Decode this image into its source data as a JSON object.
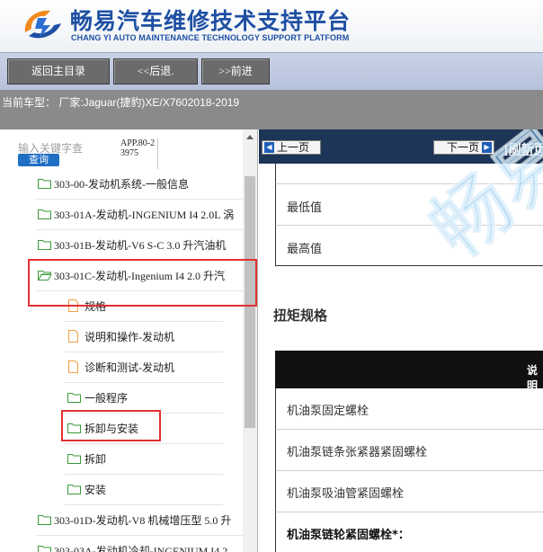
{
  "header": {
    "title_cn": "畅易汽车维修技术支持平台",
    "title_en": "CHANG YI AUTO MAINTENANCE TECHNOLOGY SUPPORT PLATFORM",
    "logo_icon": "cy-logo-icon"
  },
  "toolbar": {
    "home_label": "返回主目录",
    "back_label": "<<后退.",
    "forward_label": ">>前进"
  },
  "vehicle": {
    "label": "当前车型： 厂家:Jaguar(捷豹)XE/X7602018-2019"
  },
  "search": {
    "label": "输入关键字查",
    "button": "查询",
    "app_code": "APP.80-23975"
  },
  "tree": {
    "items": [
      {
        "label": "303-00-发动机系统-一般信息",
        "icon": "folder-icon"
      },
      {
        "label": "303-01A-发动机-INGENIUM I4 2.0L 涡",
        "icon": "folder-icon"
      },
      {
        "label": "303-01B-发动机-V6 S-C 3.0 升汽油机",
        "icon": "folder-icon"
      },
      {
        "label": "303-01C-发动机-Ingenium I4 2.0 升汽",
        "icon": "folder-open-icon"
      },
      {
        "label": "规格",
        "icon": "document-icon"
      },
      {
        "label": "说明和操作-发动机",
        "icon": "document-icon"
      },
      {
        "label": "诊断和测试-发动机",
        "icon": "document-icon"
      },
      {
        "label": "一般程序",
        "icon": "folder-icon"
      },
      {
        "label": "拆卸与安装",
        "icon": "folder-icon"
      },
      {
        "label": "拆卸",
        "icon": "folder-icon"
      },
      {
        "label": "安装",
        "icon": "folder-icon"
      },
      {
        "label": "303-01D-发动机-V8 机械增压型 5.0 升",
        "icon": "folder-icon"
      },
      {
        "label": "303-03A-发动机冷却-INGENIUM I4 2",
        "icon": "folder-icon"
      }
    ]
  },
  "pager": {
    "prev_label": "上一页",
    "next_label": "下一页",
    "refresh_label": "[刷新页"
  },
  "content": {
    "spec_rows": [
      "最低值",
      "最高值"
    ],
    "section_title": "扭矩规格",
    "table_header": "说明",
    "torque_rows": [
      {
        "label": "机油泵固定螺栓",
        "bold": false
      },
      {
        "label": "机油泵链条张紧器紧固螺栓",
        "bold": false
      },
      {
        "label": "机油泵吸油管紧固螺栓",
        "bold": false
      },
      {
        "label": "机油泵链轮紧固螺栓*：",
        "bold": true
      }
    ],
    "watermark": "畅易"
  },
  "colors": {
    "brand_blue": "#1e4fa3",
    "dark_bar": "#1d3557",
    "highlight_red": "#e03131",
    "folder_green": "#3a9a3a",
    "doc_orange": "#f0a040"
  }
}
